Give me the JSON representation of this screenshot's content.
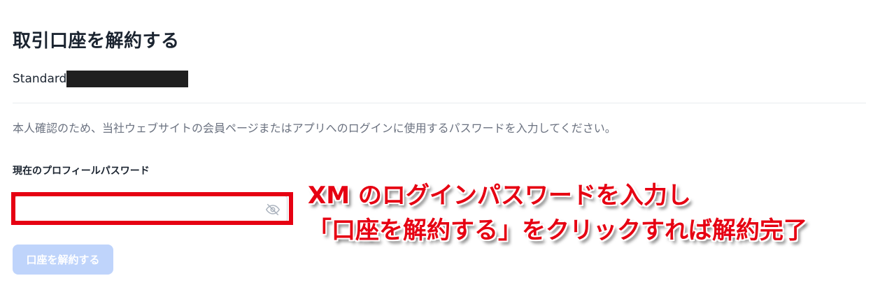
{
  "page": {
    "title": "取引口座を解約する",
    "account_type": "Standard",
    "instruction": "本人確認のため、当社ウェブサイトの会員ページまたはアプリへのログインに使用するパスワードを入力してください。"
  },
  "password_field": {
    "label": "現在のプロフィールパスワード",
    "value": "",
    "placeholder": "",
    "toggle_icon": "eye-slash-icon"
  },
  "actions": {
    "close_account_label": "口座を解約する",
    "close_account_color": "#bfd4fb"
  },
  "annotation": {
    "line1": "XM のログインパスワードを入力し",
    "line2": "「口座を解約する」をクリックすれば解約完了",
    "color": "#e60012"
  }
}
